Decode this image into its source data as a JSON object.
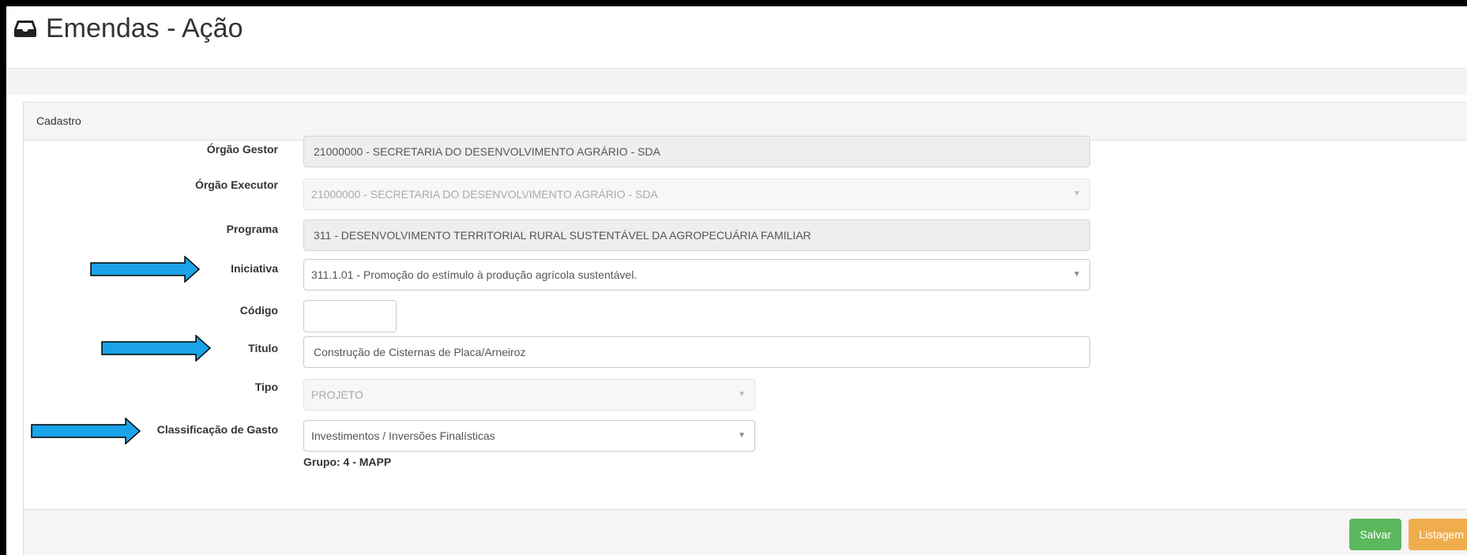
{
  "page": {
    "title": "Emendas - Ação",
    "icon": "inbox-icon"
  },
  "panel": {
    "heading": "Cadastro"
  },
  "form": {
    "orgao_gestor": {
      "label": "Órgão Gestor",
      "value": "21000000 - SECRETARIA DO DESENVOLVIMENTO AGRÁRIO - SDA"
    },
    "orgao_executor": {
      "label": "Órgão Executor",
      "value": "21000000 - SECRETARIA DO DESENVOLVIMENTO AGRÁRIO - SDA"
    },
    "programa": {
      "label": "Programa",
      "value": "311 - DESENVOLVIMENTO TERRITORIAL RURAL SUSTENTÁVEL DA AGROPECUÁRIA FAMILIAR"
    },
    "iniciativa": {
      "label": "Iniciativa",
      "value": "311.1.01 - Promoção do estímulo à produção agrícola sustentável."
    },
    "codigo": {
      "label": "Código",
      "value": ""
    },
    "titulo": {
      "label": "Titulo",
      "value": "Construção de Cisternas de Placa/Arneiroz"
    },
    "tipo": {
      "label": "Tipo",
      "value": "PROJETO"
    },
    "classificacao": {
      "label": "Classificação de Gasto",
      "value": "Investimentos / Inversões Finalísticas",
      "help": "Grupo: 4 - MAPP"
    }
  },
  "buttons": {
    "save": "Salvar",
    "list": "Listagem"
  },
  "colors": {
    "arrow": "#1aa3e8",
    "save": "#5cb85c",
    "list": "#f0ad4e"
  },
  "icons": {
    "caret": "▼"
  }
}
